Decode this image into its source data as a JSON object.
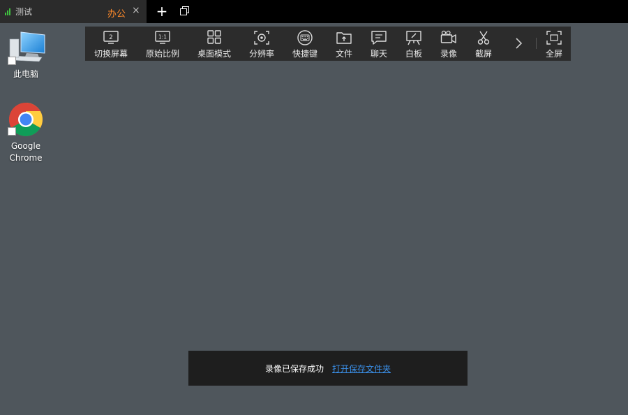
{
  "tabs": {
    "inactive_label": "测试",
    "active_label": "办公",
    "close_glyph": "×",
    "new_tab_glyph": "+"
  },
  "toolbar": {
    "items": [
      {
        "label": "切换屏幕",
        "icon": "monitor-2-icon"
      },
      {
        "label": "原始比例",
        "icon": "ratio-1-1-icon"
      },
      {
        "label": "桌面模式",
        "icon": "grid-icon"
      },
      {
        "label": "分辨率",
        "icon": "resolution-icon"
      },
      {
        "label": "快捷键",
        "icon": "keyboard-icon"
      },
      {
        "label": "文件",
        "icon": "folder-upload-icon"
      },
      {
        "label": "聊天",
        "icon": "chat-icon"
      },
      {
        "label": "白板",
        "icon": "whiteboard-icon"
      },
      {
        "label": "录像",
        "icon": "video-camera-icon"
      },
      {
        "label": "截屏",
        "icon": "scissors-icon"
      }
    ],
    "fullscreen_label": "全屏"
  },
  "desktop": {
    "icons": [
      {
        "label": "此电脑",
        "icon": "computer-icon"
      },
      {
        "label1": "Google",
        "label2": "Chrome",
        "icon": "chrome-icon"
      }
    ]
  },
  "toast": {
    "message": "录像已保存成功",
    "link": "打开保存文件夹"
  },
  "colors": {
    "desktop_bg": "#4f565c",
    "active_tab_text": "#ff8a2a",
    "link": "#3a8ee6",
    "signal": "#3fbf3f"
  }
}
